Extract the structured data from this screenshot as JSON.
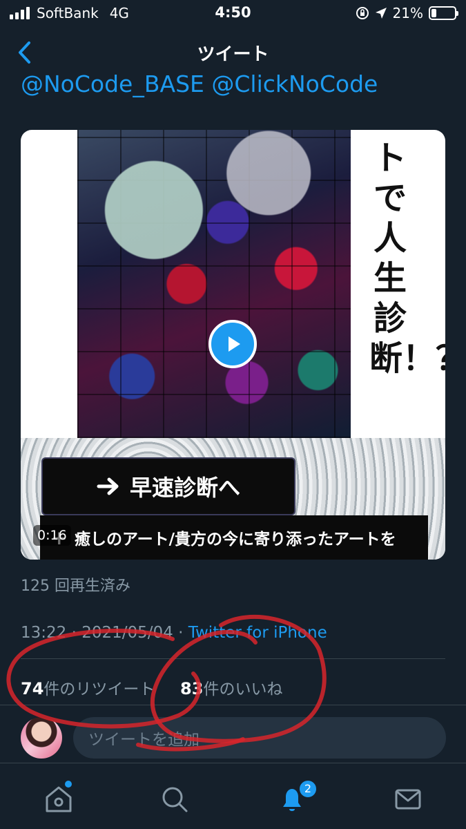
{
  "status_bar": {
    "carrier": "SoftBank",
    "network": "4G",
    "time": "4:50",
    "battery": "21%",
    "battery_level": 0.21
  },
  "nav": {
    "title": "ツイート",
    "back_icon": "chevron-left-icon"
  },
  "tweet": {
    "mentions": "@NoCode_BASE @ClickNoCode",
    "video": {
      "vertical_title": "トで人生診断！？",
      "cta_label": "早速診断へ",
      "caption": "癒しのアート/貴方の今に寄り添ったアートを",
      "duration": "0:16",
      "play_icon": "play-icon"
    },
    "views": "125 回再生済み",
    "time": "13:22",
    "date": "2021/05/04",
    "separator": "·",
    "source": "Twitter for iPhone",
    "retweets": {
      "count": "74",
      "label": "件のリツイート"
    },
    "likes": {
      "count": "83",
      "label": "件のいいね"
    }
  },
  "reply": {
    "placeholder": "ツイートを追加"
  },
  "tabbar": {
    "items": [
      {
        "name": "home",
        "icon": "home-icon"
      },
      {
        "name": "search",
        "icon": "search-icon"
      },
      {
        "name": "notifications",
        "icon": "bell-icon",
        "badge": "2"
      },
      {
        "name": "messages",
        "icon": "mail-icon"
      }
    ]
  },
  "colors": {
    "background": "#15202b",
    "accent": "#1d9bf0",
    "muted": "#8899a6",
    "annotation": "#d7262c"
  }
}
